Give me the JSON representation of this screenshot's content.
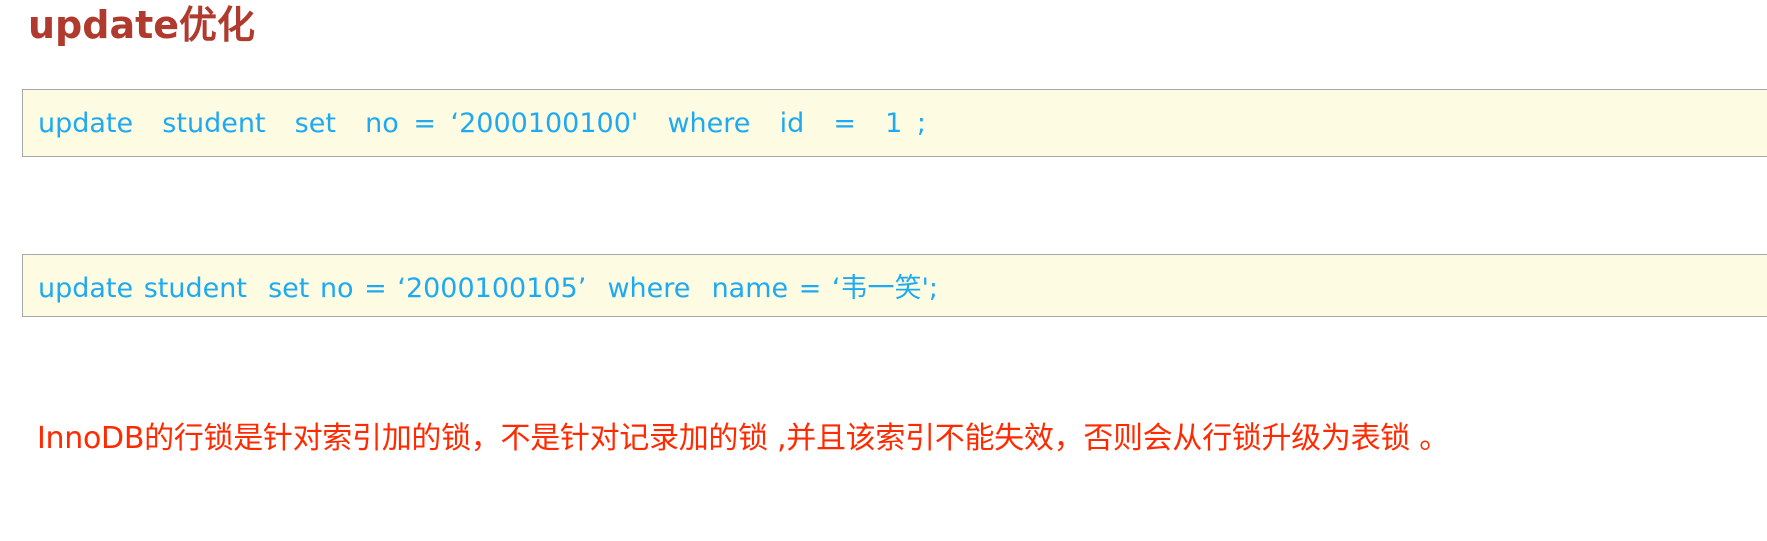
{
  "heading": "update优化",
  "sql_examples": [
    "update  student  set  no = ‘2000100100'  where  id  =  1 ;",
    "update student  set no = ‘2000100105’  where  name = ‘韦一笑';"
  ],
  "note": "InnoDB的行锁是针对索引加的锁，不是针对记录加的锁 ,并且该索引不能失效，否则会从行锁升级为表锁 。",
  "colors": {
    "heading": "#b03a2e",
    "code_text": "#1eaaf1",
    "code_background": "#fefbe3",
    "note_text": "#ff2a00"
  }
}
